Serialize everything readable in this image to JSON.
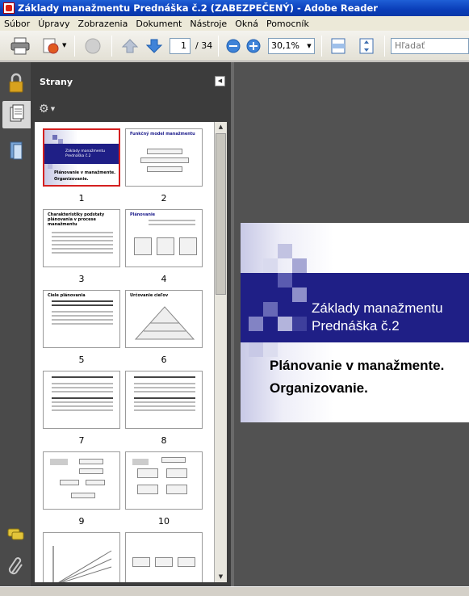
{
  "window": {
    "title": "Základy manažmentu Prednáška č.2 (ZABEZPEČENÝ) - Adobe Reader"
  },
  "menu": [
    "Súbor",
    "Úpravy",
    "Zobrazenia",
    "Dokument",
    "Nástroje",
    "Okná",
    "Pomocník"
  ],
  "toolbar": {
    "current_page": "1",
    "total_pages": "/ 34",
    "zoom": "30,1%",
    "search_placeholder": "Hľadať"
  },
  "panel": {
    "title": "Strany",
    "thumbnails": [
      {
        "page": "1",
        "title": "Základy manažmentu Prednáška č.2",
        "selected": true
      },
      {
        "page": "2",
        "title": "Funkčný model manažmentu"
      },
      {
        "page": "3",
        "title": "Charakteristiky podstaty plánovania v procese manažmentu"
      },
      {
        "page": "4",
        "title": "Plánovanie"
      },
      {
        "page": "5",
        "title": "Ciele plánovania"
      },
      {
        "page": "6",
        "title": "Určovanie cieľov"
      },
      {
        "page": "7",
        "title": ""
      },
      {
        "page": "8",
        "title": ""
      },
      {
        "page": "9",
        "title": ""
      },
      {
        "page": "10",
        "title": ""
      }
    ]
  },
  "slide": {
    "title_line1": "Základy manažmentu",
    "title_line2": "Prednáška č.2",
    "subtitle_line1": "Plánovanie v manažmente.",
    "subtitle_line2": "Organizovanie.",
    "colors": {
      "band": "#1f1f86",
      "panel_bg": "#3c3c3c",
      "selection": "#d42020"
    }
  }
}
